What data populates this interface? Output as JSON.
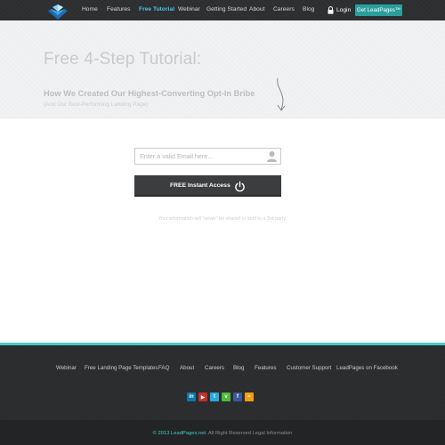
{
  "nav": {
    "items": [
      {
        "label": "Home",
        "active": false
      },
      {
        "label": "Features",
        "active": false
      },
      {
        "label": "Free Tutorial",
        "active": true
      },
      {
        "label": "Webinar",
        "active": false
      },
      {
        "label": "Getting Started",
        "active": false
      },
      {
        "label": "About",
        "active": false
      },
      {
        "label": "Careers",
        "active": false
      },
      {
        "label": "Blog",
        "active": false
      }
    ],
    "login_label": "Login",
    "cta_label": "Get LeadPages™"
  },
  "hero": {
    "title": "Free 4-Step Tutorial:",
    "subtitle": "How We Created Our Highest-Converting Opt-In Bribe",
    "subtitle2": "(And Our Best-Performing Landing Page)"
  },
  "form": {
    "email_placeholder": "Enter a valid Email here...",
    "submit_label": "FREE Instant Access",
    "privacy": "Your information will \"never\" be shared or sold to a 3rd party."
  },
  "footer": {
    "links": [
      "Webinar",
      "Free Landing Page Templates",
      "FAQ",
      "About",
      "Careers",
      "Blog",
      "Features",
      "Customer Support",
      "LeadPages on Facebook"
    ],
    "social_icons": [
      "linkedin-icon",
      "youtube-icon",
      "twitter-icon",
      "vimeo-icon",
      "facebook-icon",
      "rss-icon"
    ],
    "copyright_brand": "© 2013 LeadPages.net",
    "copyright_rest": ". All Right Reserved Legal Information"
  },
  "colors": {
    "nav_bg": "#2c2e30",
    "accent": "#4cc3ee",
    "cta": "#2a9e9c",
    "footer_accent": "#3fd0c4"
  }
}
